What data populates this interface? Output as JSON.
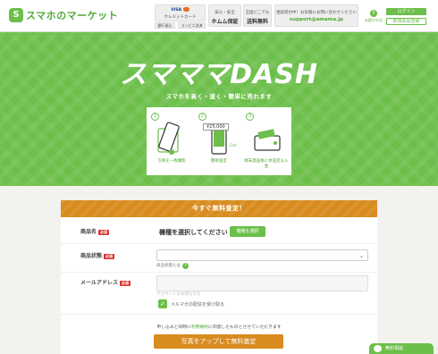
{
  "header": {
    "logo_text": "スマホのマーケット",
    "payment": {
      "brand": "VISA",
      "label": "クレジットカード",
      "sub1": "銀行振込",
      "sub2": "コンビニ決済"
    },
    "box_guarantee": {
      "line1": "安心・安全",
      "line2": "ホムム保証"
    },
    "box_shipping": {
      "line1": "全国どこでも",
      "line2": "送料無料"
    },
    "box_contact": {
      "line1": "相談受付中！お気軽にお問い合わせください",
      "line2": "support@amama.jp"
    },
    "help_label": "お困りの方",
    "login_label": "ログイン",
    "register_label": "新規会員登録"
  },
  "hero": {
    "title": "スマママDASH",
    "subtitle": "スマホを高く・速く・簡単に売れます",
    "steps": [
      {
        "num": "1",
        "caption": "写真を一枚撮影"
      },
      {
        "num": "2",
        "caption": "簡易査定",
        "price": "¥25,000"
      },
      {
        "num": "3",
        "caption": "端末発送後に本査定＆入金"
      }
    ]
  },
  "form": {
    "header": "今すぐ無料査定！",
    "required": "必須",
    "model": {
      "label": "商品名",
      "text": "機種を選択してください",
      "button": "機種を選択"
    },
    "condition": {
      "label": "商品状態",
      "about": "商品状態とは"
    },
    "email": {
      "label": "メールアドレス",
      "placeholder": "アカウントをお持ちの方"
    },
    "newsletter": "メルマガの配信を受け取る",
    "note_before": "申し込みと同時に",
    "note_link": "利用規約",
    "note_after": "に同意したものとさせていただきます",
    "submit": "写真をアップして無料査定"
  },
  "chat": {
    "label": "無料相談"
  },
  "colors": {
    "brand_green": "#6cbf4a",
    "accent_orange": "#d88b1e",
    "required_red": "#d9302d"
  }
}
